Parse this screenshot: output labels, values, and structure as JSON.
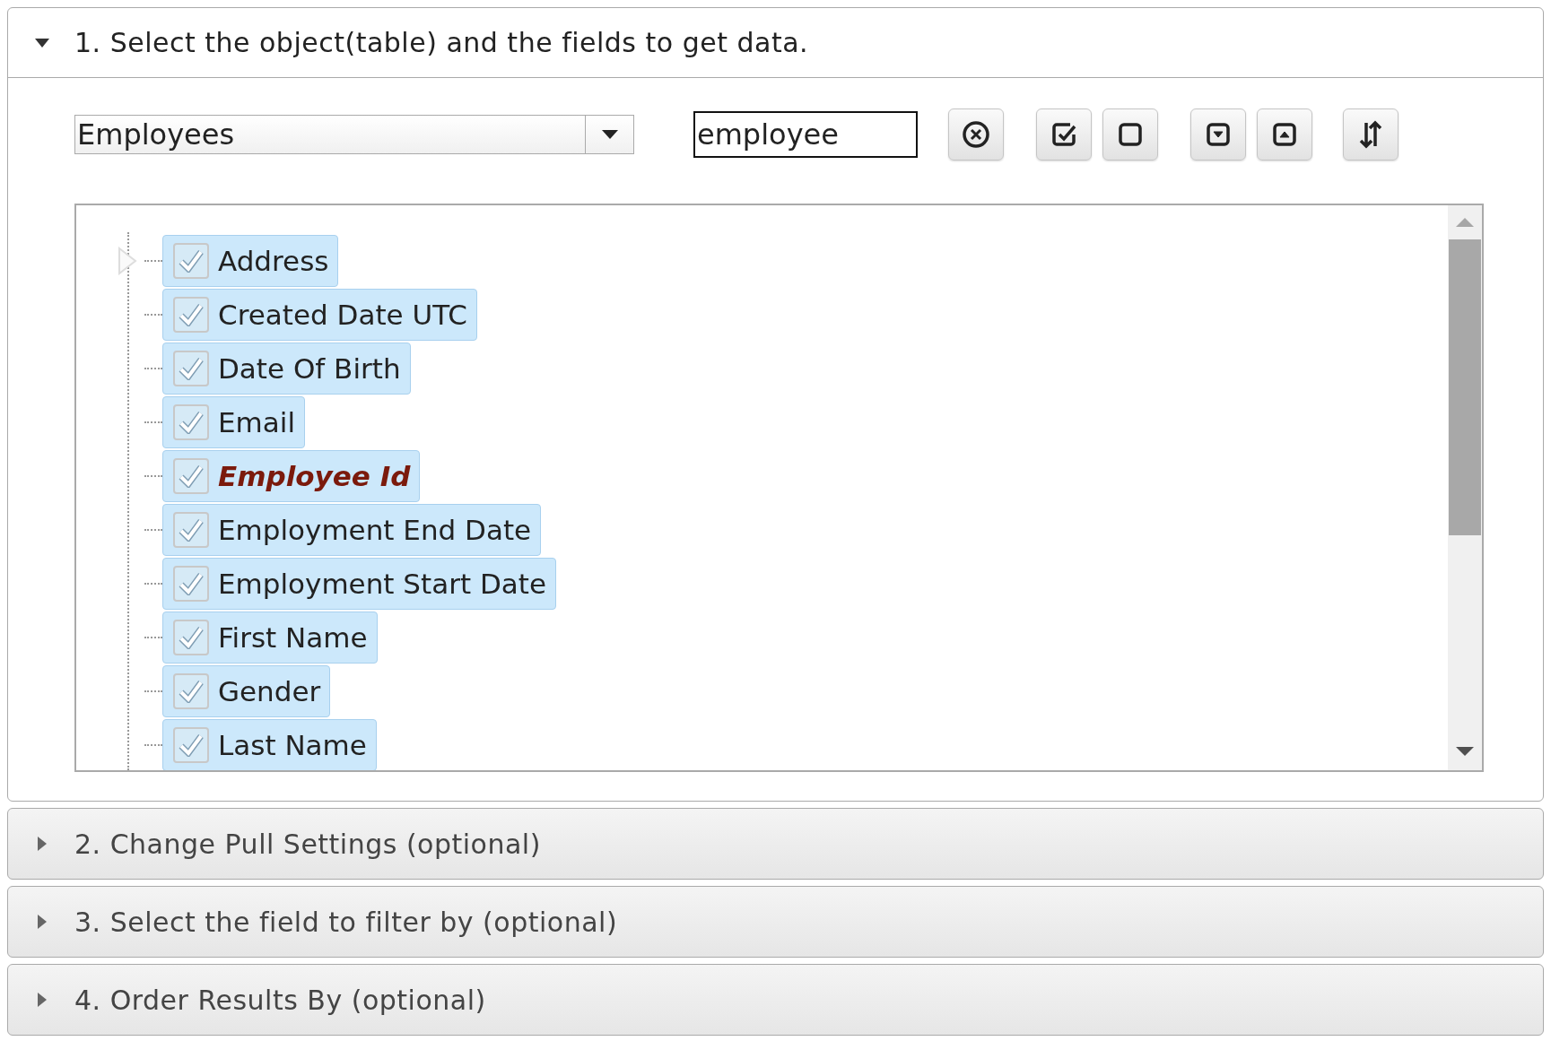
{
  "sections": [
    {
      "title": "1. Select the object(table) and the fields to get data.",
      "expanded": true
    },
    {
      "title": "2. Change Pull Settings (optional)",
      "expanded": false
    },
    {
      "title": "3. Select the field to filter by (optional)",
      "expanded": false
    },
    {
      "title": "4. Order Results By (optional)",
      "expanded": false
    }
  ],
  "object_select": {
    "value": "Employees"
  },
  "search": {
    "value": "employee"
  },
  "fields": [
    {
      "label": "Address",
      "checked": true,
      "highlighted": false,
      "expandable": true
    },
    {
      "label": "Created Date UTC",
      "checked": true,
      "highlighted": false,
      "expandable": false
    },
    {
      "label": "Date Of Birth",
      "checked": true,
      "highlighted": false,
      "expandable": false
    },
    {
      "label": "Email",
      "checked": true,
      "highlighted": false,
      "expandable": false
    },
    {
      "label": "Employee Id",
      "checked": true,
      "highlighted": true,
      "expandable": false
    },
    {
      "label": "Employment End Date",
      "checked": true,
      "highlighted": false,
      "expandable": false
    },
    {
      "label": "Employment Start Date",
      "checked": true,
      "highlighted": false,
      "expandable": false
    },
    {
      "label": "First Name",
      "checked": true,
      "highlighted": false,
      "expandable": false
    },
    {
      "label": "Gender",
      "checked": true,
      "highlighted": false,
      "expandable": false
    },
    {
      "label": "Last Name",
      "checked": true,
      "highlighted": false,
      "expandable": false
    }
  ]
}
